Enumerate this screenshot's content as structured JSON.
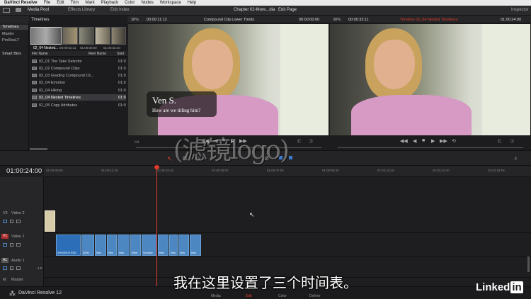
{
  "menubar": {
    "app_name": "DaVinci Resolve",
    "items": [
      "File",
      "Edit",
      "Trim",
      "Mark",
      "Playback",
      "Color",
      "Nodes",
      "Workspace",
      "Help"
    ]
  },
  "topbar": {
    "media_pool": "Media Pool",
    "effects_library": "Effects Library",
    "edit_index": "Edit Index",
    "window_title": "Chapter 02-More...dia",
    "page_title": "Edit Page",
    "inspector": "Inspector"
  },
  "bins": {
    "items": [
      "Timelines",
      "Master",
      "ProResLT"
    ],
    "smart_bins": "Smart Bins"
  },
  "pool_header": "Timelines",
  "thumb_caption": {
    "name": "02_04 Nested...",
    "tc1": "00:00:02:11",
    "tc2": "01:00:00:00",
    "tc3": "01:00:33:10"
  },
  "clip_list": {
    "col_file": "File Name",
    "col_reel": "Reel Name",
    "col_start": "Start",
    "rows": [
      {
        "name": "02_01 The Take Selector",
        "start": "01:0"
      },
      {
        "name": "02_02 Compound Clips",
        "start": "01:0"
      },
      {
        "name": "02_03 Grading Compound Cli...",
        "start": "01:0"
      },
      {
        "name": "02_04 Emotion",
        "start": "01:0"
      },
      {
        "name": "02_04 Hiking",
        "start": "01:0"
      },
      {
        "name": "02_04 Nested Timelines",
        "start": "01:0"
      },
      {
        "name": "02_05 Copy Attributes",
        "start": "01:0"
      }
    ]
  },
  "source_viewer": {
    "zoom": "38%",
    "duration": "00:00:11:12",
    "title": "Compound Clip Lower Thirds",
    "timecode": "00:00:00:00",
    "lower_third_name": "Ven S.",
    "lower_third_sub": "How are we titling him?"
  },
  "timeline_viewer": {
    "zoom": "38%",
    "duration": "00:00:33:11",
    "title": "Timeline 02_04 Nested Timelines",
    "timecode": "01:00:24:00"
  },
  "timeline": {
    "current_tc": "01:00:24:00",
    "ruler": [
      "01:00:00:00",
      "01:00:11:18",
      "01:00:23:13",
      "01:00:35:07",
      "01:00:47:02",
      "01:00:58:20",
      "01:01:10:15",
      "01:01:22:10",
      "01:01:34:04"
    ],
    "tracks": {
      "v2": {
        "badge": "V2",
        "name": "Video 2"
      },
      "v1": {
        "badge": "V1",
        "name": "Video 1"
      },
      "a1": {
        "badge": "A1",
        "name": "Audio 1",
        "level": "1.0"
      },
      "master": {
        "badge": "M",
        "name": "Master"
      }
    },
    "clip_labels": [
      "00000003.R3D",
      "0000",
      "Nes",
      "Nes",
      "Nes",
      "Nest",
      "Scooter",
      "Nes",
      "Nes",
      "Nes",
      "Nes"
    ]
  },
  "pagebar": {
    "brand": "DaVinci Resolve 12",
    "pages": [
      "Media",
      "Edit",
      "Color",
      "Deliver"
    ]
  },
  "subtitle": "我在这里设置了三个时间表。",
  "watermark": "(滤镜logo)",
  "linkedin": {
    "text": "Linked",
    "badge": "in"
  },
  "colors": {
    "accent_red": "#e23b2b",
    "clip_blue": "#4d87c1",
    "clip_beige": "#d6ccaa"
  }
}
